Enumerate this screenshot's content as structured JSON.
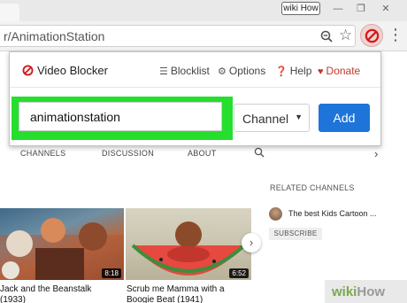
{
  "browser": {
    "wiki_tag": "wiki How",
    "address": "r/AnimationStation",
    "window_buttons": [
      "—",
      "❐",
      "✕"
    ]
  },
  "popup": {
    "brand": "Video Blocker",
    "links": {
      "blocklist": "Blocklist",
      "options": "Options",
      "help": "Help",
      "donate": "Donate"
    },
    "input_value": "animationstation",
    "select_value": "Channel",
    "add_label": "Add",
    "colors": {
      "accent_blue": "#1e74d9",
      "highlight": "#26de2e",
      "donate_red": "#c0392b"
    }
  },
  "page": {
    "tabs": [
      "CHANNELS",
      "DISCUSSION",
      "ABOUT"
    ],
    "related_heading": "RELATED CHANNELS",
    "related_channel": "The best Kids Cartoon ...",
    "subscribe": "SUBSCRIBE",
    "videos": [
      {
        "title_line1": "Jack and the Beanstalk",
        "title_line2": "(1933)",
        "duration": "8:18"
      },
      {
        "title_line1": "Scrub me Mamma with a",
        "title_line2": "Boogie Beat (1941)",
        "duration": "6:52"
      }
    ]
  },
  "watermark": {
    "wiki": "wiki",
    "how": "How"
  }
}
